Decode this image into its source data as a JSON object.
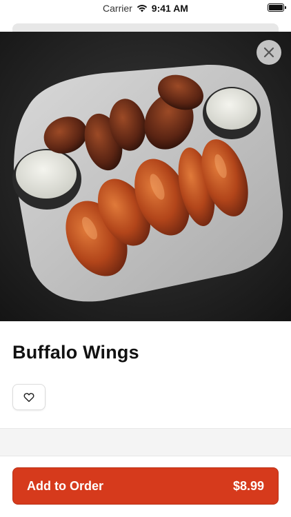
{
  "status_bar": {
    "carrier": "Carrier",
    "time": "9:41 AM"
  },
  "item": {
    "name": "Buffalo Wings",
    "image_subject": "buffalo wings with ranch dipping sauce on white plate"
  },
  "actions": {
    "close_icon": "close-icon",
    "favorite_icon": "heart-outline-icon",
    "add_to_order_label": "Add to Order",
    "price": "$8.99"
  },
  "colors": {
    "accent": "#d63a1c",
    "background": "#ffffff",
    "band": "#f4f4f4"
  }
}
